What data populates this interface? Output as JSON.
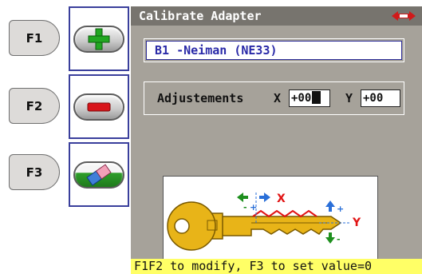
{
  "fkeys": {
    "f1": "F1",
    "f2": "F2",
    "f3": "F3"
  },
  "side_buttons": [
    {
      "icon": "plus-icon",
      "color": "#22a722"
    },
    {
      "icon": "minus-icon",
      "color": "#d8141a"
    },
    {
      "icon": "eraser-icon",
      "color": "#2e9e2a"
    }
  ],
  "screen": {
    "title": "Calibrate Adapter",
    "adapter_name": "B1 -Neiman (NE33)",
    "adjustments": {
      "label": "Adjustements",
      "x_label": "X",
      "x_value": "+00",
      "y_label": "Y",
      "y_value": "+00"
    },
    "diagram": {
      "x_axis": "X",
      "y_axis": "Y"
    },
    "hint": "F1F2 to modify, F3 to set value=0"
  },
  "colors": {
    "screen_bg": "#a6a29a",
    "titlebar": "#77746e",
    "panel_border": "#3a3f9c",
    "hint_bg": "#ffff66",
    "key_gold": "#e8b418"
  }
}
